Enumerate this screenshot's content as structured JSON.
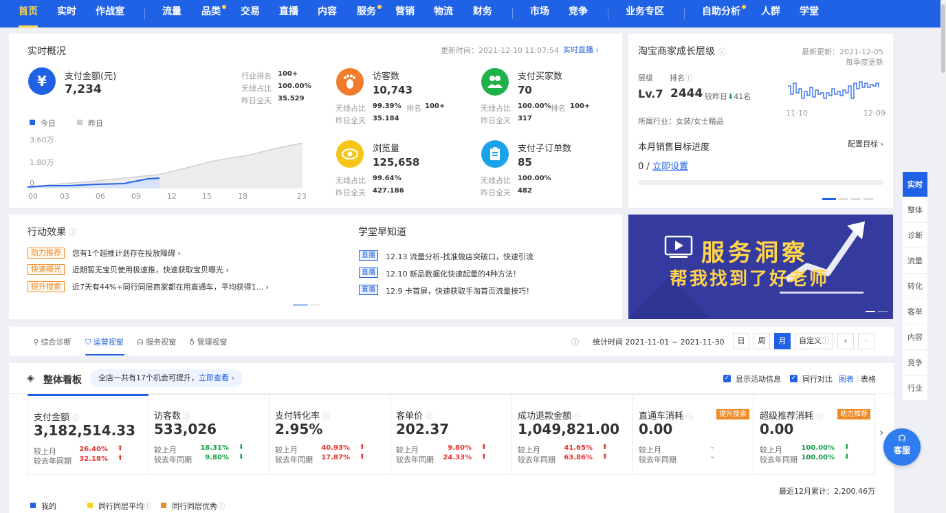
{
  "nav": {
    "items": [
      "首页",
      "实时",
      "作战室",
      "流量",
      "品类",
      "交易",
      "直播",
      "内容",
      "服务",
      "营销",
      "物流",
      "财务",
      "市场",
      "竞争",
      "业务专区",
      "自助分析",
      "人群",
      "学堂"
    ]
  },
  "realtime": {
    "title": "实时概况",
    "update_time": "更新时间：2021-12-10 11:07:54",
    "live_link": "实时直播",
    "pay": {
      "label": "支付金额(元)",
      "value": "7,234",
      "s1l": "行业排名",
      "s1v": "100+",
      "s2l": "无线占比",
      "s2v": "100.00%",
      "s3l": "昨日全天",
      "s3v": "35.529"
    },
    "legend_today": "今日",
    "legend_yest": "昨日",
    "y_ticks": [
      "3.60万",
      "1.80万",
      "0"
    ],
    "x_ticks": [
      "00",
      "03",
      "06",
      "09",
      "12",
      "15",
      "18",
      "23"
    ],
    "visitors": {
      "label": "访客数",
      "value": "10,743",
      "a": "无线占比",
      "av": "99.39%",
      "rk": "排名",
      "rkv": "100+",
      "b": "昨日全天",
      "bv": "35.184"
    },
    "buyers": {
      "label": "支付买家数",
      "value": "70",
      "a": "无线占比",
      "av": "100.00%",
      "rk": "排名",
      "rkv": "100+",
      "b": "昨日全天",
      "bv": "317"
    },
    "pv": {
      "label": "浏览量",
      "value": "125,658",
      "a": "无线占比",
      "av": "99.64%",
      "b": "昨日全天",
      "bv": "427.186"
    },
    "orders": {
      "label": "支付子订单数",
      "value": "85",
      "a": "无线占比",
      "av": "100.00%",
      "b": "昨日全天",
      "bv": "482"
    }
  },
  "growth": {
    "title": "淘宝商家成长层级",
    "latest": "最新更新：2021-12-05",
    "quarterly": "每季度更新",
    "level_label": "层级",
    "rank_label": "排名",
    "level": "Lv.7",
    "rank": "2444",
    "compare": "较昨日",
    "delta": "41名",
    "spark_start": "11-10",
    "spark_end": "12-09",
    "industry": "所属行业：女装/女士精品",
    "target_title": "本月销售目标进度",
    "config": "配置目标",
    "target_value": "0 /",
    "set_link": "立即设置"
  },
  "action": {
    "title": "行动效果",
    "items": [
      {
        "tag": "助力推荐",
        "text": "您有1个超推计划存在投放障碍"
      },
      {
        "tag": "快速曝光",
        "text": "近期暂无宝贝使用极速推，快速获取宝贝曝光"
      },
      {
        "tag": "提升搜索",
        "text": "近7天有44%+同行同层商家都在用直通车，平均获得1..."
      }
    ]
  },
  "school": {
    "title": "学堂早知道",
    "items": [
      {
        "tag": "直播",
        "text": "12.13 流量分析-找准做店突破口，快速引流"
      },
      {
        "tag": "直播",
        "text": "12.10 新品数据化快速起量的4种方法！"
      },
      {
        "tag": "直播",
        "text": "12.9 卡首屏，快速获取手淘首页流量技巧！"
      }
    ]
  },
  "banner": {
    "line1": "服务洞察",
    "line2": "帮我找到了好老师"
  },
  "tabs": {
    "items": [
      "综合诊断",
      "运营视窗",
      "服务视窗",
      "管理视窗"
    ],
    "stat_time": "统计时间 2021-11-01 ~ 2021-11-30",
    "periods": [
      "日",
      "周",
      "月",
      "自定义"
    ]
  },
  "board": {
    "title": "整体看板",
    "tip": "全店一共有17个机会可提升，",
    "tip_link": "立即查看",
    "opt1": "显示活动信息",
    "opt2": "同行对比",
    "view_chart": "图表",
    "view_table": "表格",
    "metrics": [
      {
        "label": "支付金额",
        "value": "3,182,514.33",
        "r1": "较上月",
        "v1": "26.40%",
        "d1": "up",
        "r2": "较去年同期",
        "v2": "32.18%",
        "d2": "up"
      },
      {
        "label": "访客数",
        "value": "533,026",
        "r1": "较上月",
        "v1": "18.31%",
        "d1": "down",
        "r2": "较去年同期",
        "v2": "9.80%",
        "d2": "down"
      },
      {
        "label": "支付转化率",
        "value": "2.95%",
        "r1": "较上月",
        "v1": "40.93%",
        "d1": "up",
        "r2": "较去年同期",
        "v2": "17.87%",
        "d2": "up"
      },
      {
        "label": "客单价",
        "value": "202.37",
        "r1": "较上月",
        "v1": "9.80%",
        "d1": "up",
        "r2": "较去年同期",
        "v2": "24.33%",
        "d2": "up"
      },
      {
        "label": "成功退款金额",
        "value": "1,049,821.00",
        "r1": "较上月",
        "v1": "41.65%",
        "d1": "up",
        "r2": "较去年同期",
        "v2": "63.86%",
        "d2": "up"
      },
      {
        "label": "直通车消耗",
        "value": "0.00",
        "r1": "较上月",
        "v1": "-",
        "d1": "none",
        "r2": "较去年同期",
        "v2": "-",
        "d2": "none",
        "badge": "提升搜索"
      },
      {
        "label": "超级推荐消耗",
        "value": "0.00",
        "r1": "较上月",
        "v1": "100.00%",
        "d1": "down",
        "r2": "较去年同期",
        "v2": "100.00%",
        "d2": "down",
        "badge": "助力推荐"
      }
    ],
    "cumulative": "最近12月累计：2,200.46万",
    "legend": [
      "我的",
      "同行同层平均",
      "同行同层优秀"
    ]
  },
  "side": {
    "items": [
      "实时",
      "整体",
      "诊断",
      "流量",
      "转化",
      "客单",
      "内容",
      "竞争",
      "行业"
    ]
  },
  "service": "客服",
  "colors": {
    "primary": "#2062e6",
    "accent": "#ffd54a",
    "up": "#e5322d",
    "down": "#17a14a",
    "orange": "#f08a24"
  }
}
